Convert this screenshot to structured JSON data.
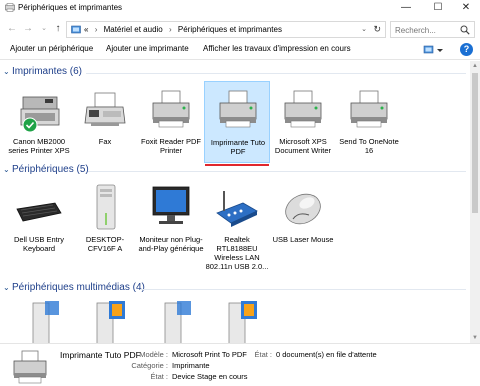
{
  "window": {
    "title": "Périphériques et imprimantes",
    "minimize_glyph": "—",
    "maximize_glyph": "☐",
    "close_glyph": "✕"
  },
  "address": {
    "prefix": "«",
    "crumbs": [
      "Matériel et audio",
      "Périphériques et imprimantes"
    ],
    "separator": "›",
    "dropdown_glyph": "⌄",
    "refresh_glyph": "↻",
    "search_placeholder": "Recherch..."
  },
  "nav": {
    "back_glyph": "←",
    "forward_glyph": "→",
    "history_glyph": "⌄",
    "up_glyph": "↑"
  },
  "commands": {
    "add_device": "Ajouter un périphérique",
    "add_printer": "Ajouter une imprimante",
    "print_queue": "Afficher les travaux d'impression en cours",
    "help": "?"
  },
  "groups": {
    "printers": {
      "label": "Imprimantes (6)",
      "items": [
        {
          "label": "Canon MB2000 series Printer XPS",
          "icon": "multifunction-printer-icon"
        },
        {
          "label": "Fax",
          "icon": "fax-icon"
        },
        {
          "label": "Foxit Reader PDF Printer",
          "icon": "printer-icon"
        },
        {
          "label": "Imprimante Tuto PDF",
          "icon": "printer-icon"
        },
        {
          "label": "Microsoft XPS Document Writer",
          "icon": "printer-icon"
        },
        {
          "label": "Send To OneNote 16",
          "icon": "printer-icon"
        }
      ]
    },
    "devices": {
      "label": "Périphériques (5)",
      "items": [
        {
          "label": "Dell USB Entry Keyboard",
          "icon": "keyboard-icon"
        },
        {
          "label": "DESKTOP-CFV16F A",
          "icon": "computer-tower-icon"
        },
        {
          "label": "Moniteur non Plug-and-Play générique",
          "icon": "monitor-icon"
        },
        {
          "label": "Realtek RTL8188EU Wireless LAN 802.11n USB 2.0...",
          "icon": "wireless-adapter-icon"
        },
        {
          "label": "USB Laser Mouse",
          "icon": "mouse-icon"
        }
      ]
    },
    "multimedia": {
      "label": "Périphériques multimédias (4)",
      "items": [
        {
          "label": "",
          "icon": "media-device-icon"
        },
        {
          "label": "",
          "icon": "media-device-icon"
        },
        {
          "label": "",
          "icon": "media-device-icon"
        },
        {
          "label": "",
          "icon": "media-device-icon"
        }
      ]
    }
  },
  "details": {
    "name": "Imprimante Tuto PDF",
    "model_label": "Modèle :",
    "model_value": "Microsoft Print To PDF",
    "category_label": "Catégorie :",
    "category_value": "Imprimante",
    "state_label": "État :",
    "state_value": "Device Stage en cours",
    "queue_label": "État :",
    "queue_value": "0 document(s) en file d'attente"
  },
  "colors": {
    "accent": "#1e3f8a",
    "selection": "#cce8ff",
    "selection_border": "#99d1ff",
    "underline": "#e0282e",
    "default_badge": "#1fa347"
  }
}
